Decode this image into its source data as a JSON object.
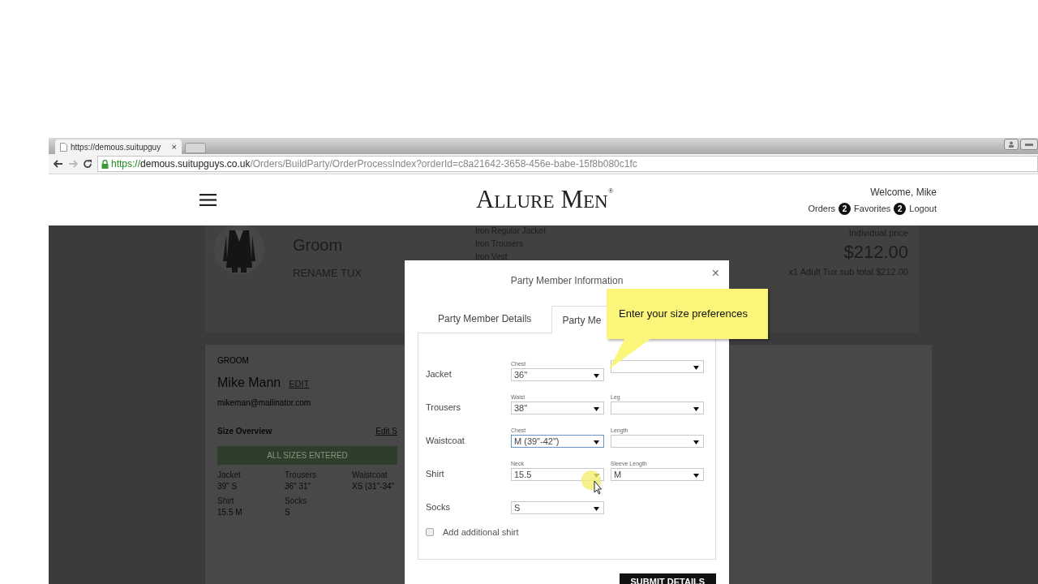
{
  "browser": {
    "tab_title": "https://demous.suitupguy",
    "tab_close": "×",
    "url": {
      "scheme": "https://",
      "host": "demous.suitupguys.co.uk",
      "path": "/Orders/BuildParty/OrderProcessIndex?orderId=c8a21642-3658-456e-babe-15f8b080c1fc"
    }
  },
  "header": {
    "logo": "ALLURE MEN",
    "logo_mark": "®",
    "welcome": "Welcome, Mike",
    "links": [
      {
        "label": "Orders",
        "badge": "2"
      },
      {
        "label": "Favorites",
        "badge": "2"
      },
      {
        "label": "Logout"
      }
    ]
  },
  "tux_card": {
    "role": "Groom",
    "rename": "RENAME TUX",
    "items": [
      "Iron Regular Jacket",
      "Iron Trousers",
      "Iron Vest"
    ],
    "price_label": "Individual price",
    "price": "$212.00",
    "subtotal": "x1 Adult Tux sub total $212.00"
  },
  "member_card": {
    "role": "GROOM",
    "name": "Mike Mann",
    "edit": "EDIT",
    "email": "mikeman@mailinator.com",
    "size_overview": "Size Overview",
    "edit_sizes": "Edit S",
    "status": "ALL SIZES ENTERED",
    "sizes": [
      {
        "label": "Jacket",
        "value": "39\" S"
      },
      {
        "label": "Trousers",
        "value": "36\" 31\""
      },
      {
        "label": "Waistcoat",
        "value": "XS (31\"-34\""
      },
      {
        "label": "Shirt",
        "value": "15.5 M"
      },
      {
        "label": "Socks",
        "value": "S"
      }
    ]
  },
  "modal": {
    "title": "Party Member Information",
    "close": "×",
    "tabs": [
      {
        "label": "Party Member Details",
        "selected": false
      },
      {
        "label": "Party Me",
        "selected": true
      }
    ],
    "rows": [
      {
        "label": "Jacket",
        "fields": [
          {
            "caption": "Chest",
            "value": "36\"",
            "focused": false
          },
          {
            "focused": false
          }
        ]
      },
      {
        "label": "Trousers",
        "fields": [
          {
            "caption": "Waist",
            "value": "38\"",
            "focused": false
          },
          {
            "caption": "Leg",
            "focused": false
          }
        ]
      },
      {
        "label": "Waistcoat",
        "fields": [
          {
            "caption": "Chest",
            "value": "M (39\"-42\")",
            "focused": true
          },
          {
            "caption": "Length",
            "focused": false
          }
        ]
      },
      {
        "label": "Shirt",
        "fields": [
          {
            "caption": "Neck",
            "value": "15.5",
            "focused": false
          },
          {
            "caption": "Sleeve Length",
            "value": "M",
            "focused": false
          }
        ]
      },
      {
        "label": "Socks",
        "fields": [
          {
            "value": "S",
            "focused": false
          }
        ]
      }
    ],
    "checkbox": {
      "label": "Add additional shirt",
      "checked": false
    },
    "submit": "SUBMIT DETAILS"
  },
  "tooltip": {
    "text": "Enter your size preferences"
  }
}
